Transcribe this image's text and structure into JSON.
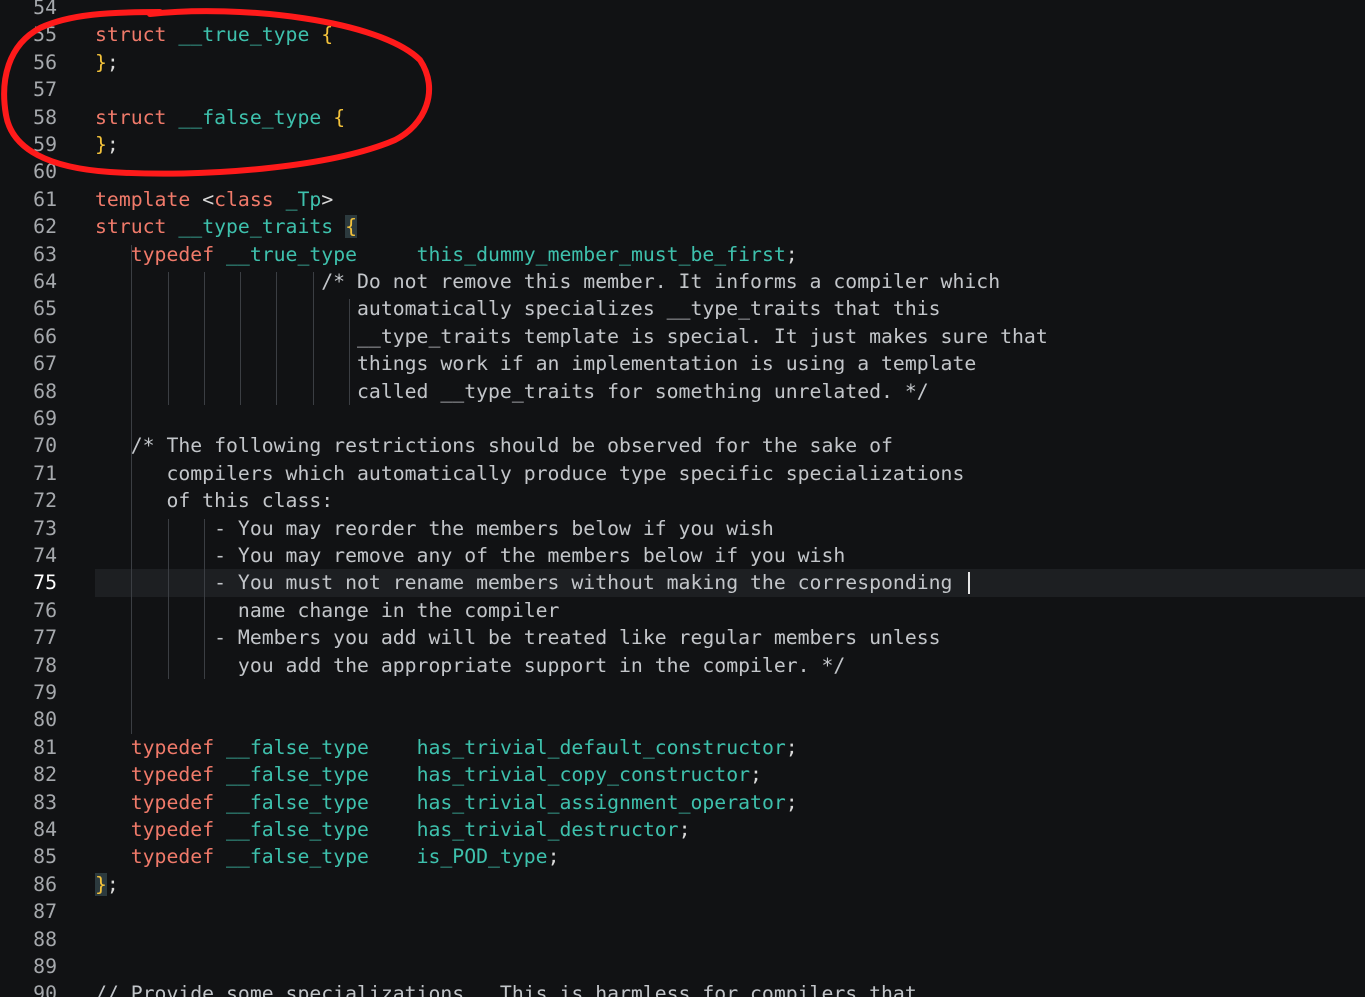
{
  "editor": {
    "current_line": "75",
    "lines": [
      {
        "n": "54",
        "tokens": []
      },
      {
        "n": "55",
        "tokens": [
          [
            "kw",
            "struct "
          ],
          [
            "ty",
            "__true_type "
          ],
          [
            "brace",
            "{"
          ]
        ]
      },
      {
        "n": "56",
        "tokens": [
          [
            "brace",
            "}"
          ],
          [
            "pun",
            ";"
          ]
        ]
      },
      {
        "n": "57",
        "tokens": []
      },
      {
        "n": "58",
        "tokens": [
          [
            "kw",
            "struct "
          ],
          [
            "ty",
            "__false_type "
          ],
          [
            "brace",
            "{"
          ]
        ]
      },
      {
        "n": "59",
        "tokens": [
          [
            "brace",
            "}"
          ],
          [
            "pun",
            ";"
          ]
        ]
      },
      {
        "n": "60",
        "tokens": []
      },
      {
        "n": "61",
        "tokens": [
          [
            "kw",
            "template "
          ],
          [
            "pun",
            "<"
          ],
          [
            "kw",
            "class "
          ],
          [
            "ty",
            "_Tp"
          ],
          [
            "pun",
            ">"
          ]
        ]
      },
      {
        "n": "62",
        "tokens": [
          [
            "kw",
            "struct "
          ],
          [
            "ty",
            "__type_traits "
          ],
          [
            "brace-match",
            "{"
          ]
        ]
      },
      {
        "n": "63",
        "tokens": [
          [
            "pun",
            "   "
          ],
          [
            "kw",
            "typedef "
          ],
          [
            "ty",
            "__true_type     "
          ],
          [
            "id",
            "this_dummy_member_must_be_first"
          ],
          [
            "pun",
            ";"
          ]
        ]
      },
      {
        "n": "64",
        "tokens": [
          [
            "cm",
            "                   /* Do not remove this member. It informs a compiler which"
          ]
        ]
      },
      {
        "n": "65",
        "tokens": [
          [
            "cm",
            "                      automatically specializes __type_traits that this"
          ]
        ]
      },
      {
        "n": "66",
        "tokens": [
          [
            "cm",
            "                      __type_traits template is special. It just makes sure that"
          ]
        ]
      },
      {
        "n": "67",
        "tokens": [
          [
            "cm",
            "                      things work if an implementation is using a template"
          ]
        ]
      },
      {
        "n": "68",
        "tokens": [
          [
            "cm",
            "                      called __type_traits for something unrelated. */"
          ]
        ]
      },
      {
        "n": "69",
        "tokens": []
      },
      {
        "n": "70",
        "tokens": [
          [
            "cm",
            "   /* The following restrictions should be observed for the sake of"
          ]
        ]
      },
      {
        "n": "71",
        "tokens": [
          [
            "cm",
            "      compilers which automatically produce type specific specializations"
          ]
        ]
      },
      {
        "n": "72",
        "tokens": [
          [
            "cm",
            "      of this class:"
          ]
        ]
      },
      {
        "n": "73",
        "tokens": [
          [
            "cm",
            "          - You may reorder the members below if you wish"
          ]
        ]
      },
      {
        "n": "74",
        "tokens": [
          [
            "cm",
            "          - You may remove any of the members below if you wish"
          ]
        ]
      },
      {
        "n": "75",
        "tokens": [
          [
            "cm",
            "          - You must not rename members without making the corresponding"
          ]
        ]
      },
      {
        "n": "76",
        "tokens": [
          [
            "cm",
            "            name change in the compiler"
          ]
        ]
      },
      {
        "n": "77",
        "tokens": [
          [
            "cm",
            "          - Members you add will be treated like regular members unless"
          ]
        ]
      },
      {
        "n": "78",
        "tokens": [
          [
            "cm",
            "            you add the appropriate support in the compiler. */"
          ]
        ]
      },
      {
        "n": "79",
        "tokens": []
      },
      {
        "n": "80",
        "tokens": []
      },
      {
        "n": "81",
        "tokens": [
          [
            "pun",
            "   "
          ],
          [
            "kw",
            "typedef "
          ],
          [
            "ty",
            "__false_type    "
          ],
          [
            "id",
            "has_trivial_default_constructor"
          ],
          [
            "pun",
            ";"
          ]
        ]
      },
      {
        "n": "82",
        "tokens": [
          [
            "pun",
            "   "
          ],
          [
            "kw",
            "typedef "
          ],
          [
            "ty",
            "__false_type    "
          ],
          [
            "id",
            "has_trivial_copy_constructor"
          ],
          [
            "pun",
            ";"
          ]
        ]
      },
      {
        "n": "83",
        "tokens": [
          [
            "pun",
            "   "
          ],
          [
            "kw",
            "typedef "
          ],
          [
            "ty",
            "__false_type    "
          ],
          [
            "id",
            "has_trivial_assignment_operator"
          ],
          [
            "pun",
            ";"
          ]
        ]
      },
      {
        "n": "84",
        "tokens": [
          [
            "pun",
            "   "
          ],
          [
            "kw",
            "typedef "
          ],
          [
            "ty",
            "__false_type    "
          ],
          [
            "id",
            "has_trivial_destructor"
          ],
          [
            "pun",
            ";"
          ]
        ]
      },
      {
        "n": "85",
        "tokens": [
          [
            "pun",
            "   "
          ],
          [
            "kw",
            "typedef "
          ],
          [
            "ty",
            "__false_type    "
          ],
          [
            "id",
            "is_POD_type"
          ],
          [
            "pun",
            ";"
          ]
        ]
      },
      {
        "n": "86",
        "tokens": [
          [
            "brace-match",
            "}"
          ],
          [
            "pun",
            ";"
          ]
        ]
      },
      {
        "n": "87",
        "tokens": []
      },
      {
        "n": "88",
        "tokens": []
      },
      {
        "n": "89",
        "tokens": []
      },
      {
        "n": "90",
        "tokens": [
          [
            "cm",
            "// Provide some specializations.  This is harmless for compilers that"
          ]
        ]
      }
    ]
  },
  "colors": {
    "background": "#111214",
    "keyword": "#f07a6a",
    "type": "#3ec1ad",
    "brace": "#f3c23b",
    "comment": "#c3c6ca",
    "annotation": "#ff1a1a"
  },
  "annotation": {
    "shape": "hand-drawn-ellipse",
    "color": "#ff1a1a",
    "encloses_lines": [
      "55",
      "59"
    ]
  }
}
